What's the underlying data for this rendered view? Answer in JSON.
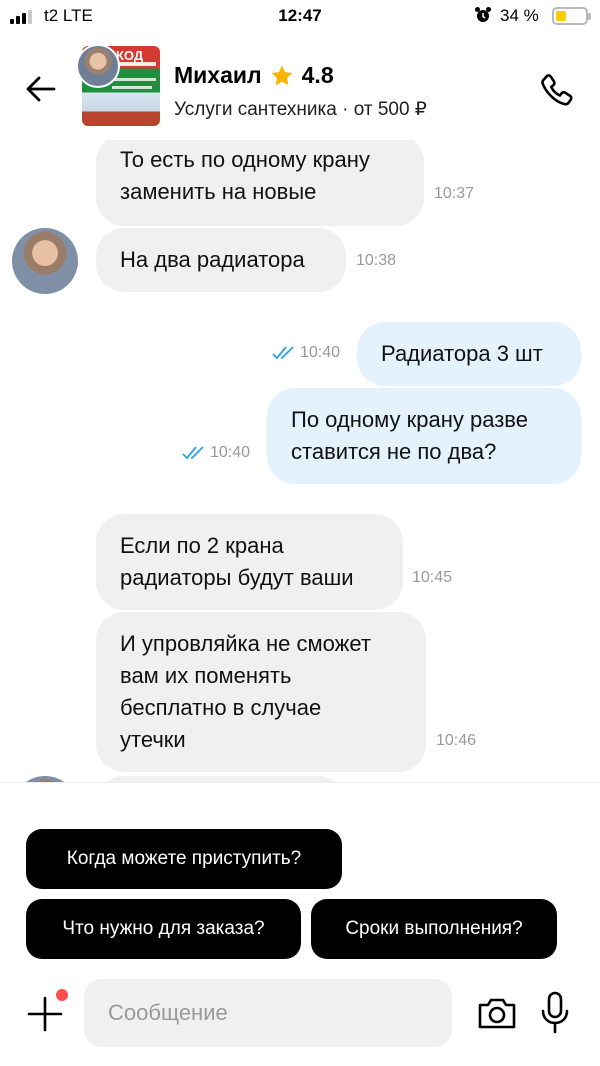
{
  "status": {
    "carrier": "t2  LTE",
    "time": "12:47",
    "battery_pct": "34 %",
    "battery_level": 0.34,
    "icons": [
      "signal-icon",
      "alarm-icon",
      "battery-icon"
    ]
  },
  "header": {
    "name": "Михаил",
    "rating": "4.8",
    "subtitle": "Услуги сантехника · от 500 ₽",
    "ad_text": "КОД",
    "star_color": "#f7b500"
  },
  "messages": [
    {
      "dir": "in",
      "lines": [
        "То есть по одному крану",
        "заменить на новые"
      ],
      "time": "10:37"
    },
    {
      "dir": "in",
      "lines": [
        "На два радиатора"
      ],
      "time": "10:38"
    },
    {
      "dir": "out",
      "lines": [
        "Радиатора 3 шт"
      ],
      "time": "10:40",
      "read": true
    },
    {
      "dir": "out",
      "lines": [
        "По одному крану разве",
        "ставится не по два?"
      ],
      "time": "10:40",
      "read": true
    },
    {
      "dir": "in",
      "lines": [
        "Если по 2 крана",
        "радиаторы будут ваши"
      ],
      "time": "10:45"
    },
    {
      "dir": "in",
      "lines": [
        "И упровляйка не сможет",
        "вам их поменять",
        "бесплатно в случае",
        "утечки"
      ],
      "time": "10:46"
    }
  ],
  "quick_replies": [
    "Когда можете приступить?",
    "Что нужно для заказа?",
    "Сроки выполнения?"
  ],
  "composer": {
    "placeholder": "Сообщение"
  },
  "colors": {
    "incoming_bubble": "#f0f0f0",
    "outgoing_bubble": "#e3f2fc",
    "read_ticks": "#2ea3e6",
    "chip_bg": "#000000",
    "notification_dot": "#ff4d4d"
  }
}
